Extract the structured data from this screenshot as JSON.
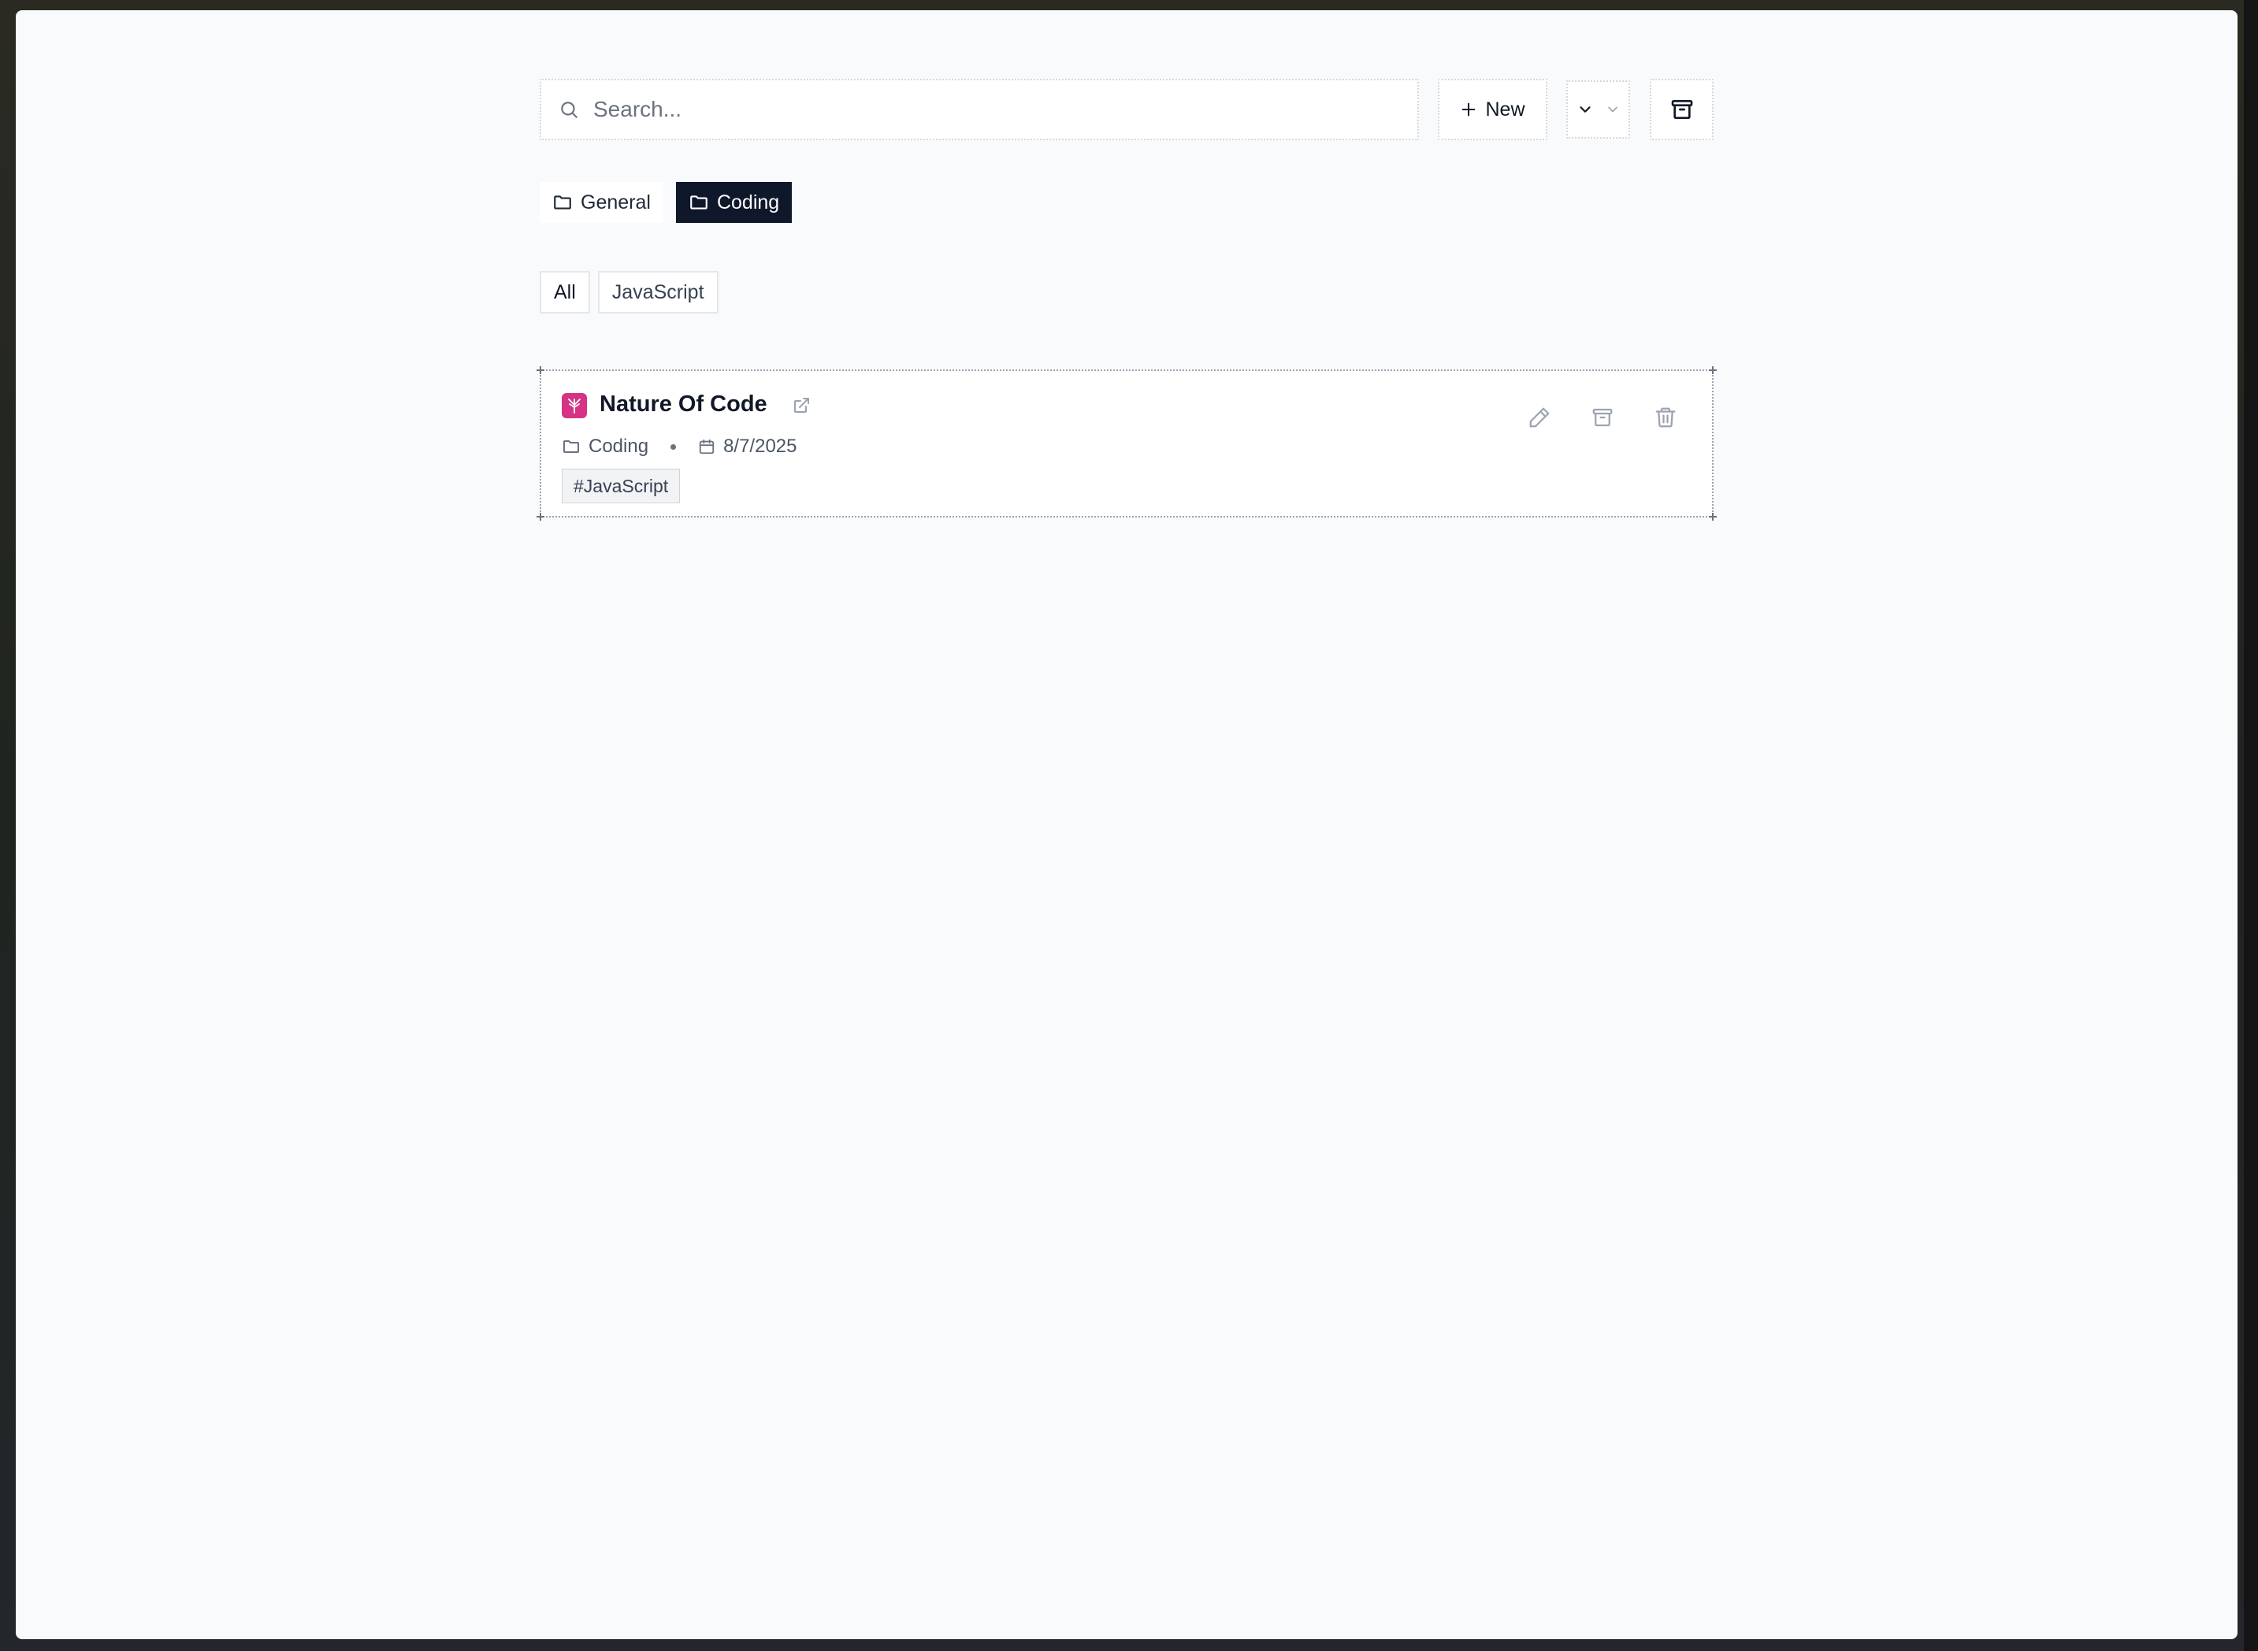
{
  "toolbar": {
    "search_placeholder": "Search...",
    "new_label": "New"
  },
  "folders": [
    {
      "label": "General",
      "active": false
    },
    {
      "label": "Coding",
      "active": true
    }
  ],
  "tag_filters": [
    {
      "label": "All",
      "active": true
    },
    {
      "label": "JavaScript",
      "active": false
    }
  ],
  "bookmark": {
    "title": "Nature Of Code",
    "folder": "Coding",
    "date": "8/7/2025",
    "tag": "#JavaScript",
    "favicon_color": "#d63384"
  },
  "colors": {
    "accent_dark": "#0f172a",
    "page_bg": "#f8fafc"
  },
  "icons": [
    "search-icon",
    "plus-icon",
    "chevron-down-icon",
    "archive-icon",
    "folder-icon",
    "external-link-icon",
    "calendar-icon",
    "pencil-icon",
    "trash-icon"
  ]
}
